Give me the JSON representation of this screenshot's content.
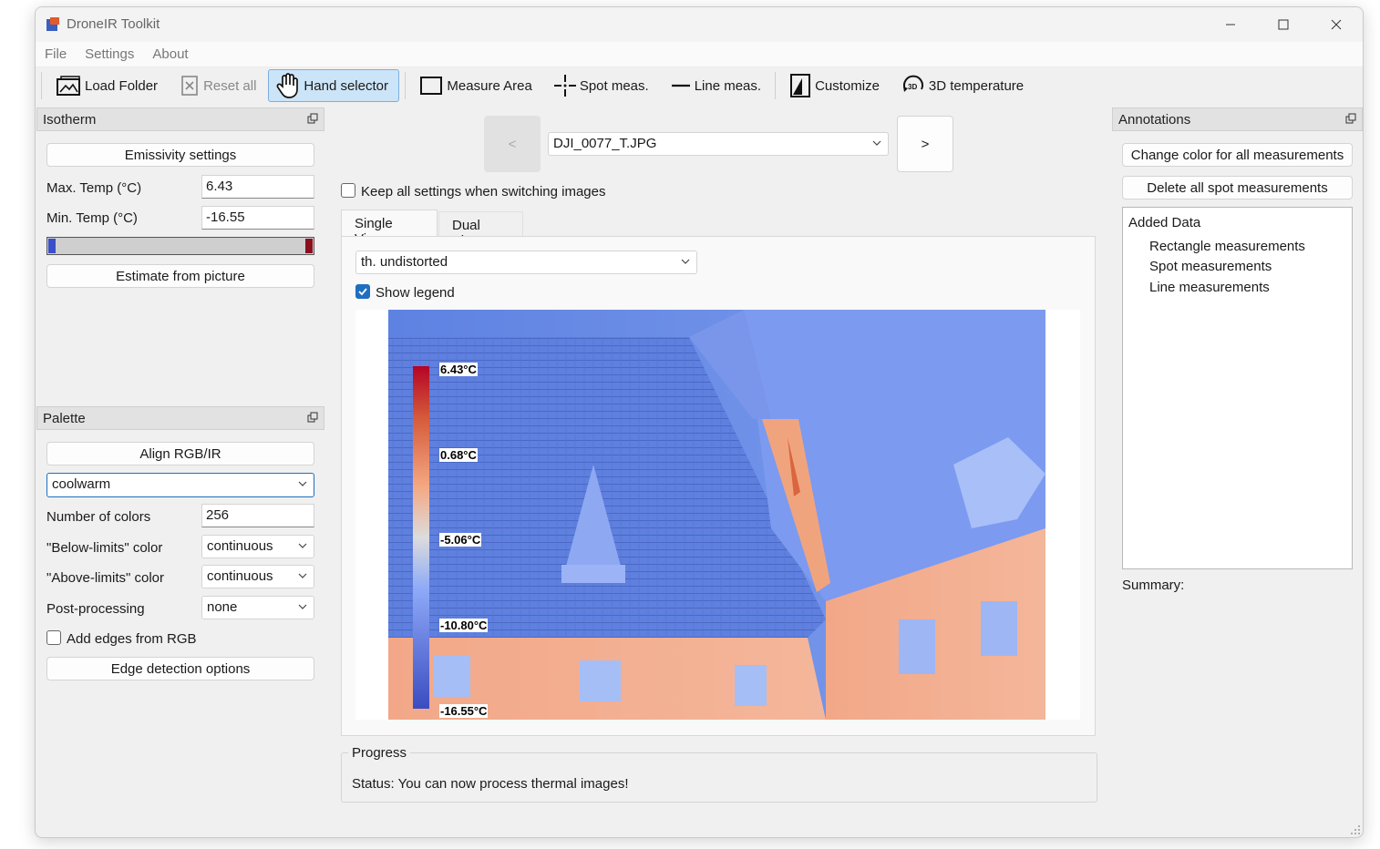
{
  "window": {
    "title": "DroneIR Toolkit"
  },
  "menu": [
    "File",
    "Settings",
    "About"
  ],
  "toolbar": {
    "load_folder": "Load Folder",
    "reset_all": "Reset all",
    "hand_selector": "Hand selector",
    "measure_area": "Measure Area",
    "spot_meas": "Spot meas.",
    "line_meas": "Line meas.",
    "customize": "Customize",
    "temp_3d": "3D temperature"
  },
  "isotherm": {
    "title": "Isotherm",
    "emissivity_btn": "Emissivity settings",
    "max_label": "Max. Temp (°C)",
    "max_value": "6.43",
    "min_label": "Min. Temp (°C)",
    "min_value": "-16.55",
    "estimate_btn": "Estimate from picture"
  },
  "palette": {
    "title": "Palette",
    "align_btn": "Align RGB/IR",
    "colormap": "coolwarm",
    "ncolors_label": "Number of colors",
    "ncolors_value": "256",
    "below_label": "\"Below-limits\" color",
    "below_value": "continuous",
    "above_label": "\"Above-limits\" color",
    "above_value": "continuous",
    "post_label": "Post-processing",
    "post_value": "none",
    "edges_label": "Add edges from RGB",
    "edge_opts_btn": "Edge detection options"
  },
  "nav": {
    "prev": "<",
    "next": ">",
    "image_file": "DJI_0077_T.JPG",
    "keep_settings": "Keep all settings when switching images"
  },
  "tabs": {
    "single": "Single View",
    "dual": "Dual View"
  },
  "view": {
    "mode": "th. undistorted",
    "show_legend": "Show legend",
    "legend_labels": [
      "6.43°C",
      "0.68°C",
      "-5.06°C",
      "-10.80°C",
      "-16.55°C"
    ]
  },
  "progress": {
    "title": "Progress",
    "status": "Status: You can now process thermal images!"
  },
  "annotations": {
    "title": "Annotations",
    "change_color_btn": "Change color for all measurements",
    "delete_spots_btn": "Delete all spot measurements",
    "tree_root": "Added Data",
    "tree_items": [
      "Rectangle measurements",
      "Spot measurements",
      "Line measurements"
    ],
    "summary": "Summary:"
  },
  "colors": {
    "accent": "#1e6fc0",
    "active_tool_bg": "#cce4f7",
    "thermal_cold": "#5a7fe0",
    "thermal_hot": "#f0a07a"
  }
}
